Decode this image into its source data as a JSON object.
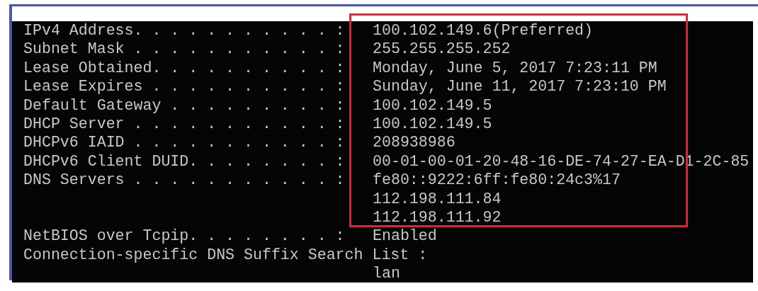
{
  "console": {
    "lines": [
      {
        "label": "IPv4 Address. . . . . . . . . . . :",
        "value": "100.102.149.6(Preferred)"
      },
      {
        "label": "Subnet Mask . . . . . . . . . . . :",
        "value": "255.255.255.252"
      },
      {
        "label": "Lease Obtained. . . . . . . . . . :",
        "value": "Monday, June 5, 2017 7:23:11 PM"
      },
      {
        "label": "Lease Expires . . . . . . . . . . :",
        "value": "Sunday, June 11, 2017 7:23:10 PM"
      },
      {
        "label": "Default Gateway . . . . . . . . . :",
        "value": "100.102.149.5"
      },
      {
        "label": "DHCP Server . . . . . . . . . . . :",
        "value": "100.102.149.5"
      },
      {
        "label": "DHCPv6 IAID . . . . . . . . . . . :",
        "value": "208938986"
      },
      {
        "label": "DHCPv6 Client DUID. . . . . . . . :",
        "value": "00-01-00-01-20-48-16-DE-74-27-EA-D1-2C-85"
      },
      {
        "label": "DNS Servers . . . . . . . . . . . :",
        "value": "fe80::9222:6ff:fe80:24c3%17"
      },
      {
        "value": "112.198.111.84"
      },
      {
        "value": "112.198.111.92"
      },
      {
        "label": "NetBIOS over Tcpip. . . . . . . . :",
        "value": "Enabled"
      },
      {
        "label": "Connection-specific DNS Suffix Search List :"
      },
      {
        "value": "lan"
      }
    ]
  }
}
